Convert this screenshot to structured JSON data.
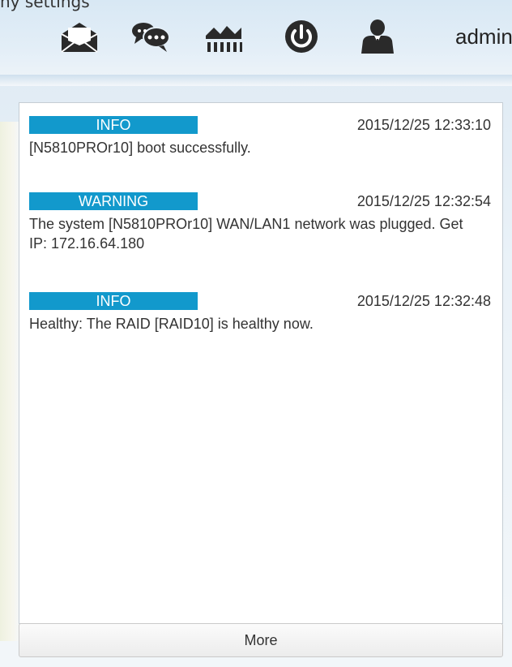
{
  "top_text": "ny settings",
  "toolbar": {
    "icons": [
      {
        "name": "mail-icon"
      },
      {
        "name": "chat-icon"
      },
      {
        "name": "network-icon"
      },
      {
        "name": "power-icon"
      },
      {
        "name": "user-icon"
      }
    ],
    "user_label": "admin"
  },
  "notifications": [
    {
      "level": "INFO",
      "timestamp": "2015/12/25 12:33:10",
      "message": "[N5810PROr10] boot successfully."
    },
    {
      "level": "WARNING",
      "timestamp": "2015/12/25 12:32:54",
      "message": "The system [N5810PROr10] WAN/LAN1 network was plugged. Get IP: 172.16.64.180"
    },
    {
      "level": "INFO",
      "timestamp": "2015/12/25 12:32:48",
      "message": "Healthy: The RAID [RAID10] is healthy now."
    }
  ],
  "more_label": "More",
  "colors": {
    "badge": "#1299cc",
    "icon": "#2a2a2a"
  }
}
